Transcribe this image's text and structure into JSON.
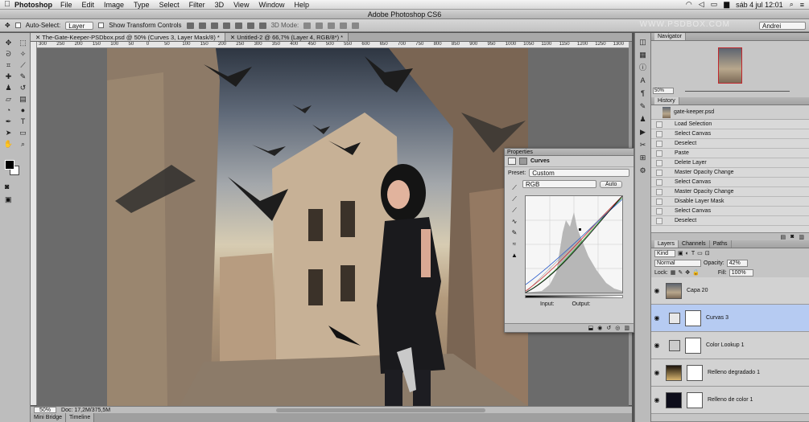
{
  "menubar": {
    "app": "Photoshop",
    "items": [
      "File",
      "Edit",
      "Image",
      "Type",
      "Select",
      "Filter",
      "3D",
      "View",
      "Window",
      "Help"
    ],
    "clock": "sáb 4 jul  12:01"
  },
  "window": {
    "title": "Adobe Photoshop CS6",
    "watermark": "WWW.PSDBOX.COM"
  },
  "options": {
    "auto_select_label": "Auto-Select:",
    "auto_select_value": "Layer",
    "show_transform_label": "Show Transform Controls",
    "mode_label": "3D Mode:",
    "workspace": "Andrei"
  },
  "tabs": [
    {
      "label": "The-Gate-Keeper-PSDbox.psd @ 50% (Curves 3, Layer Mask/8) *"
    },
    {
      "label": "Untitled-2 @ 66,7% (Layer 4, RGB/8*) *"
    }
  ],
  "ruler_ticks": [
    "300",
    "250",
    "200",
    "150",
    "100",
    "50",
    "0",
    "50",
    "100",
    "150",
    "200",
    "250",
    "300",
    "350",
    "400",
    "450",
    "500",
    "550",
    "600",
    "650",
    "700",
    "750",
    "800",
    "850",
    "900",
    "950",
    "1000",
    "1050",
    "1100",
    "1150",
    "1200",
    "1250",
    "1300"
  ],
  "status": {
    "zoom": "50%",
    "doc": "Doc: 17,2M/375,5M"
  },
  "bottom_tabs": [
    "Mini Bridge",
    "Timeline"
  ],
  "properties": {
    "title": "Properties",
    "adjustment": "Curves",
    "preset_label": "Preset:",
    "preset_value": "Custom",
    "channel_value": "RGB",
    "auto_button": "Auto",
    "input_label": "Input:",
    "output_label": "Output:"
  },
  "navigator": {
    "title": "Navigator",
    "zoom": "50%"
  },
  "history": {
    "title": "History",
    "snapshot": "gate-keeper.psd",
    "items": [
      "Load Selection",
      "Select Canvas",
      "Deselect",
      "Paste",
      "Delete Layer",
      "Master Opacity Change",
      "Select Canvas",
      "Master Opacity Change",
      "Disable Layer Mask",
      "Select Canvas",
      "Deselect"
    ]
  },
  "layers_panel": {
    "tabs": [
      "Layers",
      "Channels",
      "Paths"
    ],
    "kind": "Kind",
    "blend": "Normal",
    "opacity_label": "Opacity:",
    "opacity_value": "42%",
    "lock_label": "Lock:",
    "fill_label": "Fill:",
    "fill_value": "100%",
    "layers": [
      {
        "name": "Capa 20",
        "selected": false
      },
      {
        "name": "Curvas 3",
        "selected": true
      },
      {
        "name": "Color Lookup 1",
        "selected": false
      },
      {
        "name": "Relleno degradado 1",
        "selected": false
      },
      {
        "name": "Relleno de color 1",
        "selected": false
      }
    ]
  },
  "colors": {
    "selection": "#b6cbf2",
    "panel": "#c8c8c8",
    "frame": "#535353"
  }
}
